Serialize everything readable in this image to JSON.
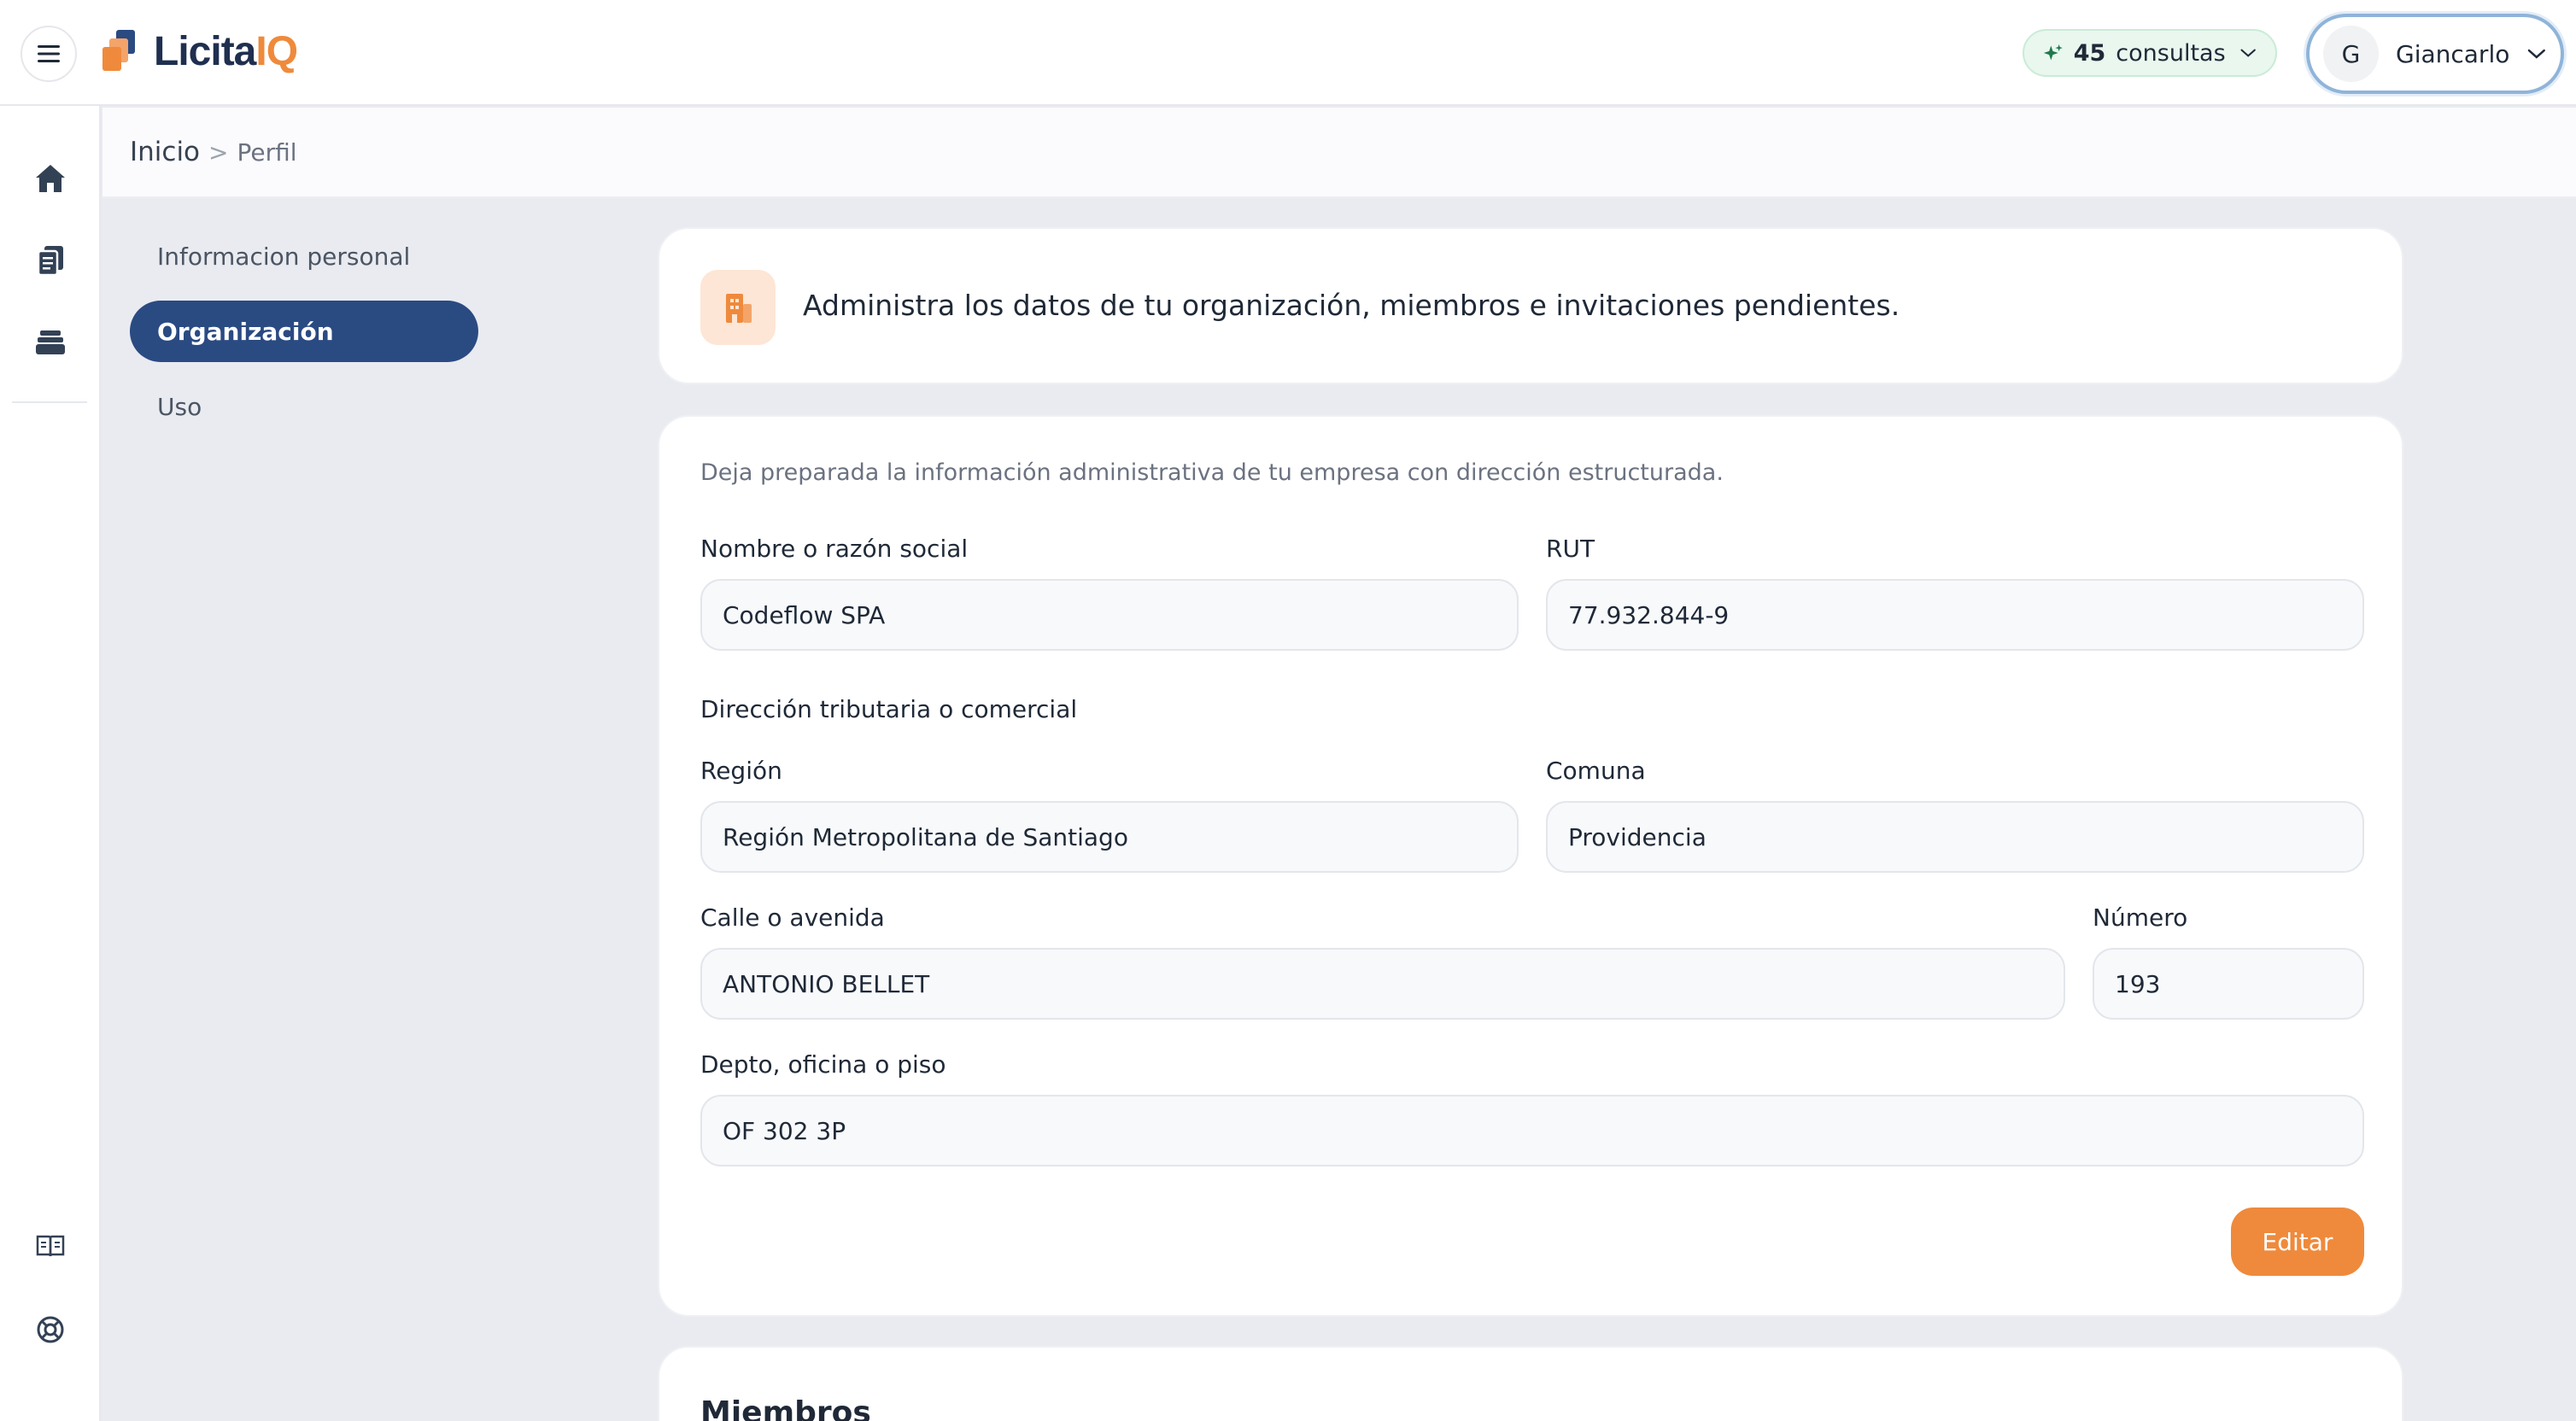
{
  "app": {
    "logo_main": "Licita",
    "logo_accent": "IQ"
  },
  "topbar": {
    "credits_count": "45",
    "credits_label": "consultas",
    "user_initial": "G",
    "user_name": "Giancarlo"
  },
  "breadcrumb": {
    "home": "Inicio",
    "separator": ">",
    "current": "Perfil"
  },
  "profile_nav": {
    "items": [
      {
        "label": "Informacion personal"
      },
      {
        "label": "Organización"
      },
      {
        "label": "Uso"
      }
    ],
    "active_index": 1
  },
  "intro": {
    "text": "Administra los datos de tu organización, miembros e invitaciones pendientes."
  },
  "organization_form": {
    "description": "Deja preparada la información administrativa de tu empresa con dirección estructurada.",
    "name_label": "Nombre o razón social",
    "name_value": "Codeflow SPA",
    "rut_label": "RUT",
    "rut_value": "77.932.844-9",
    "address_section": "Dirección tributaria o comercial",
    "region_label": "Región",
    "region_value": "Región Metropolitana de Santiago",
    "comuna_label": "Comuna",
    "comuna_value": "Providencia",
    "street_label": "Calle o avenida",
    "street_value": "ANTONIO BELLET",
    "number_label": "Número",
    "number_value": "193",
    "unit_label": "Depto, oficina o piso",
    "unit_value": "OF 302 3P",
    "edit_button": "Editar"
  },
  "members": {
    "title": "Miembros"
  },
  "colors": {
    "brand_navy": "#2a4a82",
    "brand_orange": "#ef8a3c",
    "credits_bg": "#e9f7ef"
  },
  "icons": {
    "menu": "hamburger-icon",
    "credits": "sparkle-icon",
    "user_dropdown": "chevron-down-icon",
    "rail": [
      "home-icon",
      "documents-icon",
      "stack-icon",
      "book-icon",
      "help-icon"
    ],
    "intro": "building-icon"
  }
}
